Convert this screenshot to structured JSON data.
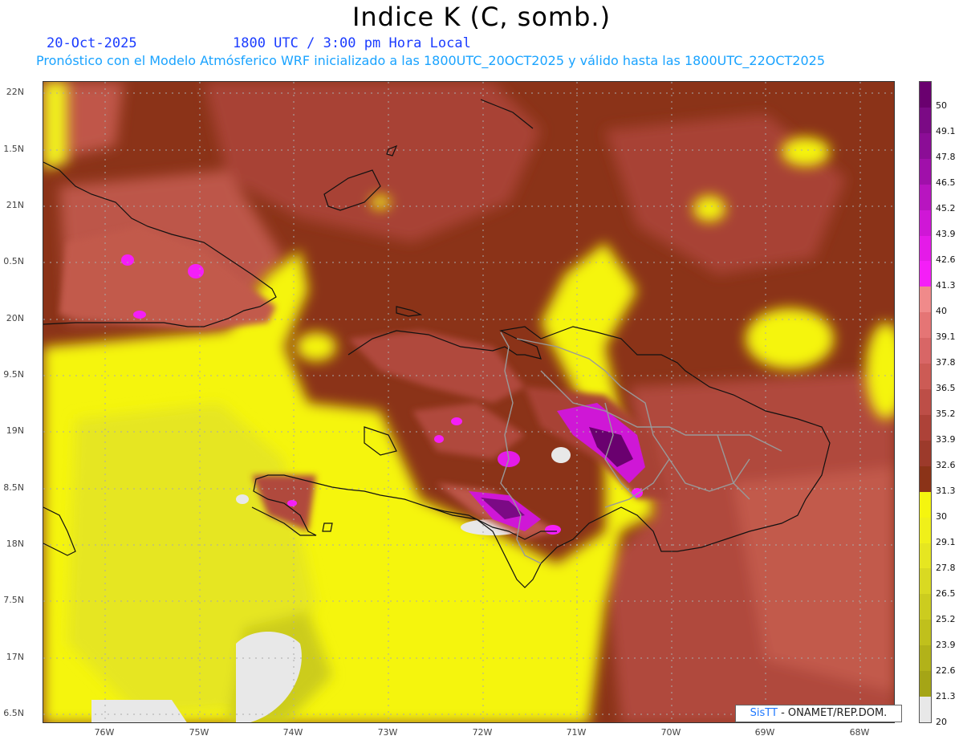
{
  "title": "Indice K (C, somb.)",
  "date": "20-Oct-2025",
  "time": "1800 UTC / 3:00 pm Hora Local",
  "description": "Pronóstico con el Modelo Atmósferico WRF inicializado a las 1800UTC_20OCT2025 y válido hasta las  1800UTC_22OCT2025",
  "lat_labels": [
    "22N",
    "1.5N",
    "21N",
    "0.5N",
    "20N",
    "9.5N",
    "19N",
    "8.5N",
    "18N",
    "7.5N",
    "17N",
    "6.5N"
  ],
  "lon_labels": [
    "76W",
    "75W",
    "74W",
    "73W",
    "72W",
    "71W",
    "70W",
    "69W",
    "68W"
  ],
  "colorbar": {
    "labels": [
      "50",
      "49.1",
      "47.8",
      "46.5",
      "45.2",
      "43.9",
      "42.6",
      "41.3",
      "40",
      "39.1",
      "37.8",
      "36.5",
      "35.2",
      "33.9",
      "32.6",
      "31.3",
      "30",
      "29.1",
      "27.8",
      "26.5",
      "25.2",
      "23.9",
      "22.6",
      "21.3",
      "20"
    ],
    "colors": [
      "#6a006f",
      "#7b0a85",
      "#8b0d96",
      "#a010aa",
      "#b815c0",
      "#cf17d6",
      "#e41be8",
      "#f41ff7",
      "#f08a8a",
      "#e57575",
      "#d86666",
      "#cc5b55",
      "#bd4e47",
      "#ad4238",
      "#9c3a2b",
      "#8b3318",
      "#f5f50f",
      "#f0f01a",
      "#e6e621",
      "#d9d922",
      "#cccc1f",
      "#c0c01c",
      "#b2b219",
      "#a5a516",
      "#e8e8e8"
    ]
  },
  "credit": {
    "brand": "SisTT",
    "org": "- ONAMET/REP.DOM."
  }
}
